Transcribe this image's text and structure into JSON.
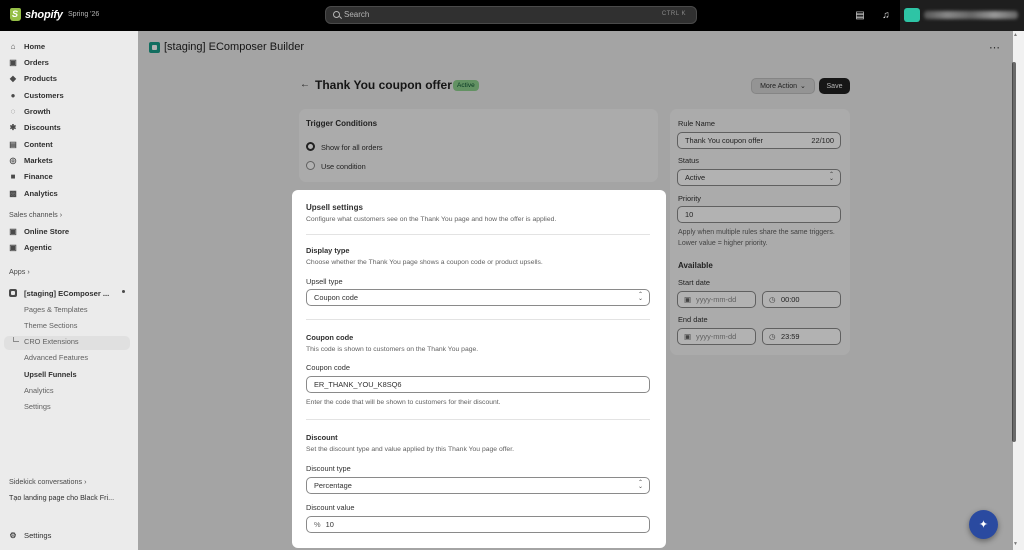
{
  "topbar": {
    "brand": "shopify",
    "edition": "Spring '26",
    "search_placeholder": "Search",
    "search_shortcut": "CTRL  K"
  },
  "sidebar": {
    "items": [
      {
        "label": "Home",
        "icon": "home-icon"
      },
      {
        "label": "Orders",
        "icon": "orders-icon"
      },
      {
        "label": "Products",
        "icon": "tag-icon"
      },
      {
        "label": "Customers",
        "icon": "person-icon"
      },
      {
        "label": "Growth",
        "icon": "growth-icon"
      },
      {
        "label": "Discounts",
        "icon": "discount-icon"
      },
      {
        "label": "Content",
        "icon": "content-icon"
      },
      {
        "label": "Markets",
        "icon": "globe-icon"
      },
      {
        "label": "Finance",
        "icon": "bank-icon"
      },
      {
        "label": "Analytics",
        "icon": "chart-icon"
      }
    ],
    "sales_channels_label": "Sales channels",
    "channels": [
      {
        "label": "Online Store"
      },
      {
        "label": "Agentic"
      }
    ],
    "apps_label": "Apps",
    "app_name": "[staging] EComposer ...",
    "app_sub_items": [
      {
        "label": "Pages & Templates"
      },
      {
        "label": "Theme Sections"
      },
      {
        "label": "CRO Extensions"
      },
      {
        "label": "Advanced Features"
      },
      {
        "label": "Upsell Funnels"
      },
      {
        "label": "Analytics"
      },
      {
        "label": "Settings"
      }
    ],
    "sidekick_label": "Sidekick conversations",
    "sidekick_item": "Tạo landing page cho Black Fri...",
    "settings_label": "Settings"
  },
  "app_header": {
    "title": "[staging] EComposer Builder"
  },
  "page": {
    "title": "Thank You coupon offer",
    "status_badge": "Active",
    "more_action": "More Action",
    "save": "Save"
  },
  "trigger": {
    "title": "Trigger Conditions",
    "options": [
      {
        "label": "Show for all orders",
        "selected": true
      },
      {
        "label": "Use condition",
        "selected": false
      }
    ]
  },
  "upsell": {
    "title": "Upsell settings",
    "description": "Configure what customers see on the Thank You page and how the offer is applied.",
    "display_type": {
      "heading": "Display type",
      "description": "Choose whether the Thank You page shows a coupon code or product upsells.",
      "field_label": "Upsell type",
      "value": "Coupon code"
    },
    "coupon": {
      "heading": "Coupon code",
      "description": "This code is shown to customers on the Thank You page.",
      "field_label": "Coupon code",
      "value": "ER_THANK_YOU_K8SQ6",
      "help": "Enter the code that will be shown to customers for their discount."
    },
    "discount": {
      "heading": "Discount",
      "description": "Set the discount type and value applied by this Thank You page offer.",
      "type_label": "Discount type",
      "type_value": "Percentage",
      "value_label": "Discount value",
      "value_prefix": "%",
      "value": "10"
    }
  },
  "rule": {
    "name_label": "Rule Name",
    "name_value": "Thank You coupon offer",
    "name_count": "22/100",
    "status_label": "Status",
    "status_value": "Active",
    "priority_label": "Priority",
    "priority_value": "10",
    "priority_help": "Apply when multiple rules share the same triggers. Lower value = higher priority.",
    "available_label": "Available",
    "start_label": "Start date",
    "start_date_placeholder": "yyyy-mm-dd",
    "start_time": "00:00",
    "end_label": "End date",
    "end_date_placeholder": "yyyy-mm-dd",
    "end_time": "23:59"
  }
}
